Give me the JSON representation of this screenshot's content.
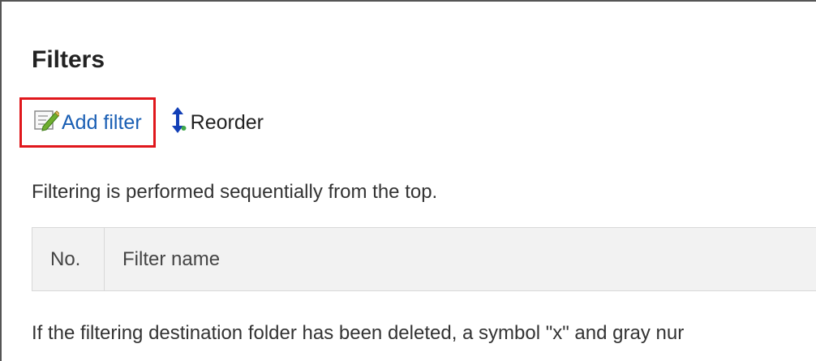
{
  "page": {
    "title": "Filters"
  },
  "toolbar": {
    "add_filter_label": "Add filter",
    "reorder_label": "Reorder"
  },
  "notes": {
    "sequential": "Filtering is performed sequentially from the top.",
    "deleted_folder": "If the filtering destination folder has been deleted, a symbol \"x\" and gray nur"
  },
  "table": {
    "columns": [
      "No.",
      "Filter name"
    ],
    "rows": []
  },
  "colors": {
    "link": "#1a5fb4",
    "highlight": "#e0171c",
    "header_bg": "#f2f2f2",
    "border": "#d8d8d8"
  },
  "icons": {
    "add_filter": "edit-note-icon",
    "reorder": "up-down-arrow-icon"
  }
}
